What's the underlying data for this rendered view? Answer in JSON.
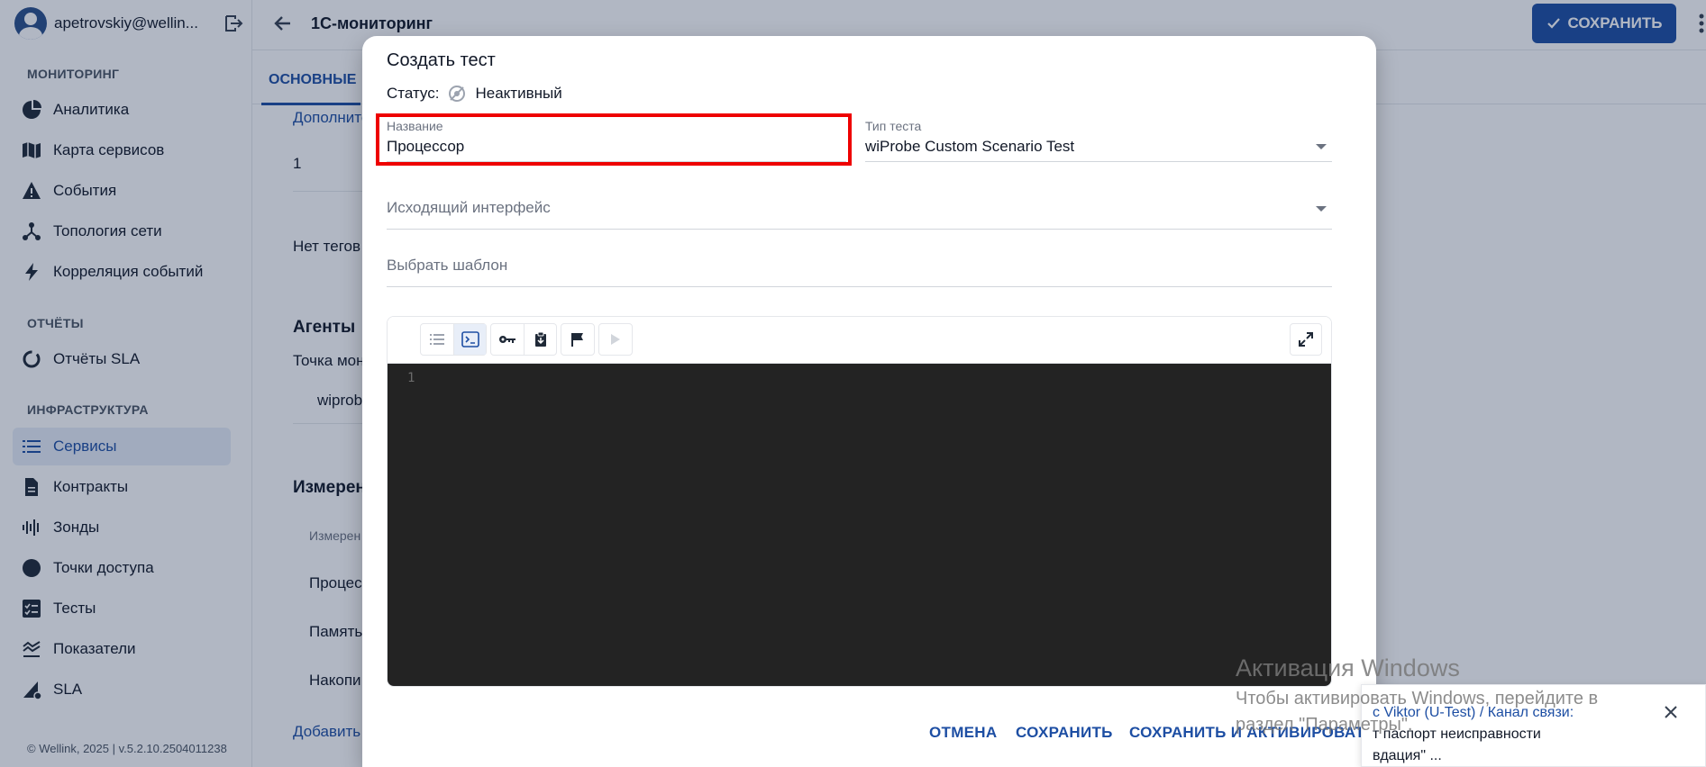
{
  "sidebar": {
    "user_email": "apetrovskiy@wellin...",
    "sections": {
      "monitoring": "МОНИТОРИНГ",
      "reports": "ОТЧЁТЫ",
      "infrastructure": "ИНФРАСТРУКТУРА"
    },
    "items": [
      {
        "label": "Аналитика",
        "icon": "pie-chart-icon"
      },
      {
        "label": "Карта сервисов",
        "icon": "map-icon"
      },
      {
        "label": "События",
        "icon": "warning-icon"
      },
      {
        "label": "Топология сети",
        "icon": "topology-icon"
      },
      {
        "label": "Корреляция событий",
        "icon": "bolt-icon"
      },
      {
        "label": "Отчёты SLA",
        "icon": "donut-icon"
      },
      {
        "label": "Сервисы",
        "icon": "list-icon",
        "active": true
      },
      {
        "label": "Контракты",
        "icon": "document-icon"
      },
      {
        "label": "Зонды",
        "icon": "waveform-icon"
      },
      {
        "label": "Точки доступа",
        "icon": "circle-icon"
      },
      {
        "label": "Тесты",
        "icon": "checklist-icon"
      },
      {
        "label": "Показатели",
        "icon": "metrics-icon"
      },
      {
        "label": "SLA",
        "icon": "sla-icon"
      }
    ],
    "footer": "© Wellink, 2025 | v.5.2.10.2504011238"
  },
  "header": {
    "title": "1С-мониторинг",
    "save_label": "СОХРАНИТЬ"
  },
  "background": {
    "tab_main": "ОСНОВНЫЕ",
    "additional": "Дополните",
    "num_one": "1",
    "no_tags": "Нет тегов",
    "agents": "Агенты",
    "monitoring_point": "Точка мон",
    "wiprobe": "wiprob",
    "measurements": "Измерен",
    "measurements_col": "Измерен",
    "row_processor": "Процес",
    "row_memory": "Память",
    "row_accum": "Накопи",
    "add": "Добавить"
  },
  "modal": {
    "title": "Создать тест",
    "status_label": "Статус:",
    "status_value": "Неактивный",
    "name_label": "Название",
    "name_value": "Процессор",
    "test_type_label": "Тип теста",
    "test_type_value": "wiProbe Custom Scenario Test",
    "interface_placeholder": "Исходящий интерфейс",
    "template_placeholder": "Выбрать шаблон",
    "editor_line_number": "1",
    "actions": {
      "cancel": "ОТМЕНА",
      "save": "СОХРАНИТЬ",
      "save_activate": "СОХРАНИТЬ И АКТИВИРОВАТЬ"
    }
  },
  "toast": {
    "line1": "с Viktor (U-Test) / Канал связи:",
    "line2": "т паспорт неисправности",
    "line3": "вдация\" ..."
  },
  "watermark": {
    "title": "Активация Windows",
    "line1": "Чтобы активировать Windows, перейдите в",
    "line2": "раздел \"Параметры\"."
  },
  "colors": {
    "accent": "#1d4ea3",
    "highlight": "#ee0000",
    "editor_bg": "#232323"
  }
}
